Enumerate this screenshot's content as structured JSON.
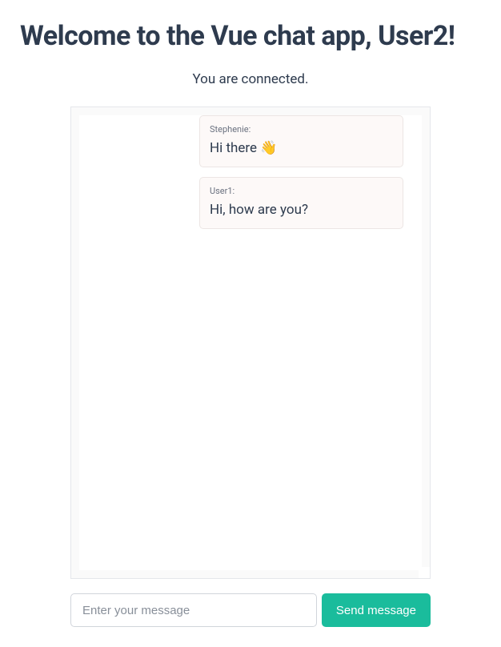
{
  "header": {
    "title": "Welcome to the Vue chat app, User2!"
  },
  "status": {
    "text": "You are connected."
  },
  "messages": [
    {
      "sender": "Stephenie:",
      "text": "Hi there 👋"
    },
    {
      "sender": "User1:",
      "text": "Hi, how are you?"
    }
  ],
  "input": {
    "placeholder": "Enter your message"
  },
  "sendButton": {
    "label": "Send message"
  }
}
